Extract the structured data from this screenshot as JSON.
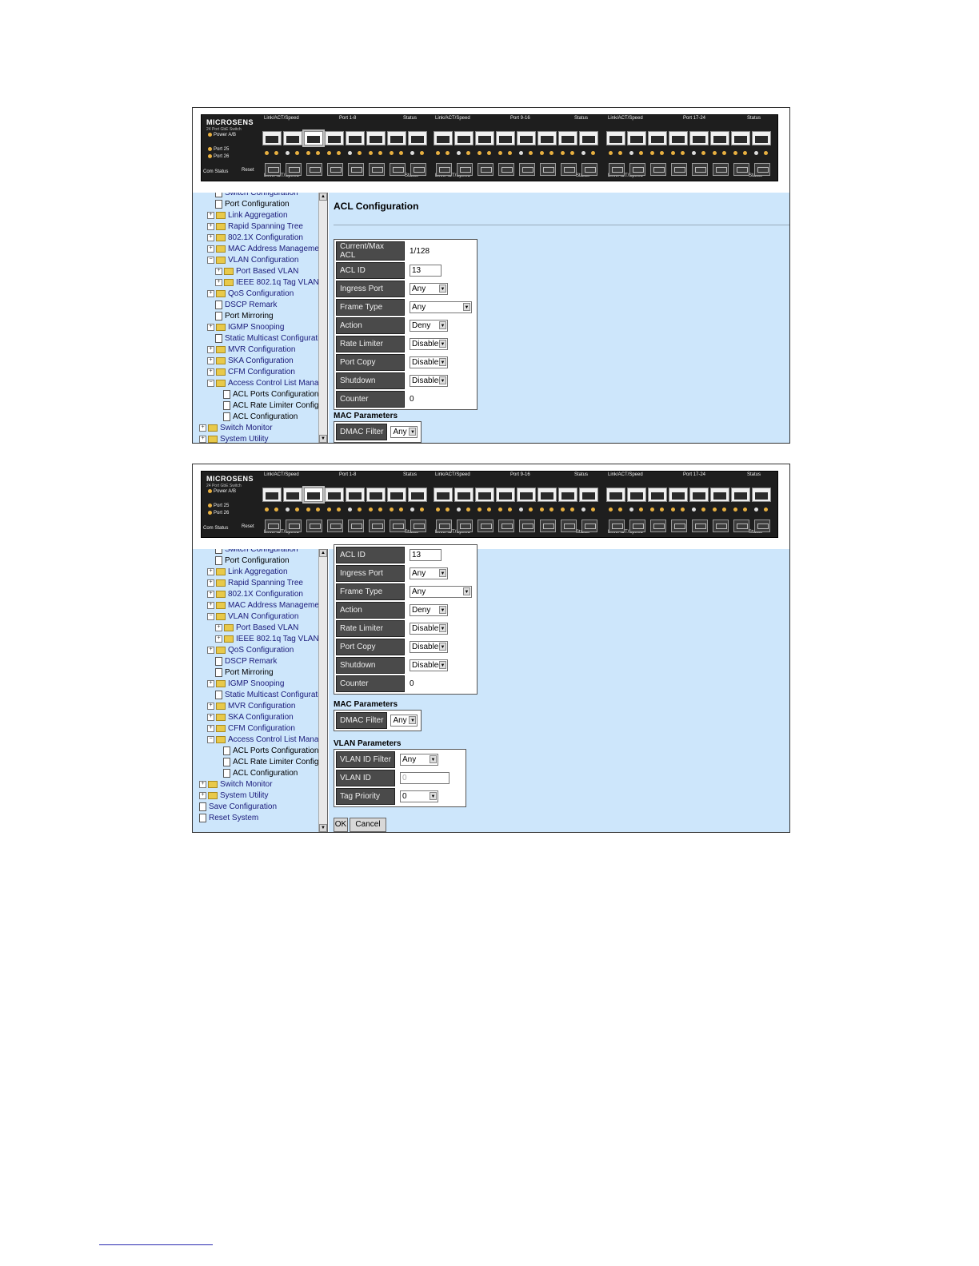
{
  "device": {
    "brand": "MICROSENS",
    "subtitle": "24 Port GbE Switch",
    "power_label": "Power A/B",
    "port25_label": "Port 25",
    "port26_label": "Port 26",
    "com_label": "Com",
    "status_label": "Status",
    "reset_label": "Reset",
    "link_act_speed": "Link/ACT/Speed",
    "groups": [
      "Port 1-8",
      "Port 9-16",
      "Port 17-24"
    ]
  },
  "tree": [
    {
      "label": "Switch Configuration",
      "type": "doc",
      "indent": 1
    },
    {
      "label": "Port Configuration",
      "type": "doc",
      "indent": 1,
      "dark": true
    },
    {
      "label": "Link Aggregation",
      "type": "folder",
      "indent": 0
    },
    {
      "label": "Rapid Spanning Tree",
      "type": "folder",
      "indent": 0
    },
    {
      "label": "802.1X Configuration",
      "type": "folder",
      "indent": 0
    },
    {
      "label": "MAC Address Managemen",
      "type": "folder",
      "indent": 0
    },
    {
      "label": "VLAN Configuration",
      "type": "folder",
      "indent": 0,
      "open": true
    },
    {
      "label": "Port Based VLAN",
      "type": "folder",
      "indent": 1
    },
    {
      "label": "IEEE 802.1q Tag VLAN",
      "type": "folder",
      "indent": 1
    },
    {
      "label": "QoS Configuration",
      "type": "folder",
      "indent": 0
    },
    {
      "label": "DSCP Remark",
      "type": "doc",
      "indent": 1
    },
    {
      "label": "Port Mirroring",
      "type": "doc",
      "indent": 1,
      "dark": true
    },
    {
      "label": "IGMP Snooping",
      "type": "folder",
      "indent": 0
    },
    {
      "label": "Static Multicast Configuratio",
      "type": "doc",
      "indent": 1
    },
    {
      "label": "MVR Configuration",
      "type": "folder",
      "indent": 0
    },
    {
      "label": "SKA Configuration",
      "type": "folder",
      "indent": 0
    },
    {
      "label": "CFM Configuration",
      "type": "folder",
      "indent": 0
    },
    {
      "label": "Access Control List Manage",
      "type": "folder",
      "indent": 0,
      "open": true
    },
    {
      "label": "ACL Ports Configuration",
      "type": "doc",
      "indent": 2,
      "dark": true
    },
    {
      "label": "ACL Rate Limiter Configu",
      "type": "doc",
      "indent": 2,
      "dark": true
    },
    {
      "label": "ACL Configuration",
      "type": "doc",
      "indent": 2,
      "dark": true
    },
    {
      "label": "Switch Monitor",
      "type": "folder",
      "indent": -1
    },
    {
      "label": "System Utility",
      "type": "folder",
      "indent": -1
    },
    {
      "label": "Save Configuration",
      "type": "doc",
      "indent": -1
    },
    {
      "label": "Reset System",
      "type": "doc",
      "indent": -1
    }
  ],
  "page_title": "ACL Configuration",
  "acl_fields": [
    {
      "label": "Current/Max ACL",
      "kind": "text",
      "value": "1/128"
    },
    {
      "label": "ACL ID",
      "kind": "input",
      "value": "13"
    },
    {
      "label": "Ingress Port",
      "kind": "select",
      "value": "Any"
    },
    {
      "label": "Frame Type",
      "kind": "select-wide",
      "value": "Any"
    },
    {
      "label": "Action",
      "kind": "select",
      "value": "Deny"
    },
    {
      "label": "Rate Limiter",
      "kind": "select",
      "value": "Disable"
    },
    {
      "label": "Port Copy",
      "kind": "select",
      "value": "Disable"
    },
    {
      "label": "Shutdown",
      "kind": "select",
      "value": "Disabled"
    },
    {
      "label": "Counter",
      "kind": "text",
      "value": "0"
    }
  ],
  "mac_section": "MAC Parameters",
  "dmac": {
    "label": "DMAC Filter",
    "value": "Any"
  },
  "vlan_section": "VLAN Parameters",
  "vlan_fields": [
    {
      "label": "VLAN ID Filter",
      "kind": "select",
      "value": "Any"
    },
    {
      "label": "VLAN ID",
      "kind": "input-dis",
      "value": "0"
    },
    {
      "label": "Tag Priority",
      "kind": "select",
      "value": "0"
    }
  ],
  "buttons": {
    "ok": "OK",
    "cancel": "Cancel"
  }
}
